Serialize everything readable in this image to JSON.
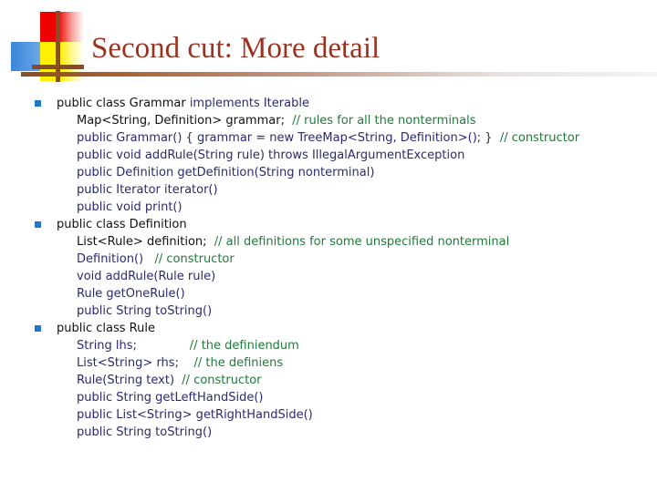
{
  "slide": {
    "title": "Second cut: More detail",
    "title_color": "#993322",
    "accent_rule_color": "#8a4c28",
    "bullet_color": "#1f78c1",
    "logo": {
      "red_color": "#ef0000",
      "blue_color": "#3a86d8",
      "yellow_color": "#ffef00",
      "cross_color": "#8a4c28"
    }
  },
  "code_groups": [
    {
      "bullet": "square-bullet",
      "lines": [
        {
          "indent": 0,
          "segments": [
            {
              "text": "public class Grammar ",
              "style": "dark"
            },
            {
              "text": "implements Iterable",
              "style": "blue"
            }
          ]
        },
        {
          "indent": 1,
          "segments": [
            {
              "text": "Map<String, Definition> grammar;  ",
              "style": "dark"
            },
            {
              "text": "// rules for all the nonterminals",
              "style": "comment"
            }
          ]
        },
        {
          "indent": 1,
          "segments": [
            {
              "text": "public Grammar() { grammar = new TreeMap<String, Definition>(); }  ",
              "style": "blue"
            },
            {
              "text": "// constructor",
              "style": "comment"
            }
          ]
        },
        {
          "indent": 1,
          "segments": [
            {
              "text": "public void addRule(String rule) throws IllegalArgumentException",
              "style": "blue"
            }
          ]
        },
        {
          "indent": 1,
          "segments": [
            {
              "text": "public Definition getDefinition(String nonterminal)",
              "style": "blue"
            }
          ]
        },
        {
          "indent": 1,
          "segments": [
            {
              "text": "public Iterator iterator()",
              "style": "blue"
            }
          ]
        },
        {
          "indent": 1,
          "segments": [
            {
              "text": "public void print()",
              "style": "blue"
            }
          ]
        }
      ]
    },
    {
      "bullet": "square-bullet",
      "lines": [
        {
          "indent": 0,
          "segments": [
            {
              "text": "public class Definition",
              "style": "dark"
            }
          ]
        },
        {
          "indent": 1,
          "segments": [
            {
              "text": "List<Rule> definition;  ",
              "style": "dark"
            },
            {
              "text": "// all definitions for some unspecified nonterminal",
              "style": "comment"
            }
          ]
        },
        {
          "indent": 1,
          "segments": [
            {
              "text": "Definition()   ",
              "style": "blue"
            },
            {
              "text": "// constructor",
              "style": "comment"
            }
          ]
        },
        {
          "indent": 1,
          "segments": [
            {
              "text": "void addRule(Rule rule)",
              "style": "blue"
            }
          ]
        },
        {
          "indent": 1,
          "segments": [
            {
              "text": "Rule getOneRule()",
              "style": "blue"
            }
          ]
        },
        {
          "indent": 1,
          "segments": [
            {
              "text": "public String toString()",
              "style": "blue"
            }
          ]
        }
      ]
    },
    {
      "bullet": "square-bullet",
      "lines": [
        {
          "indent": 0,
          "segments": [
            {
              "text": "public class Rule",
              "style": "dark"
            }
          ]
        },
        {
          "indent": 1,
          "segments": [
            {
              "text": "String lhs;              ",
              "style": "blue"
            },
            {
              "text": "// the definiendum",
              "style": "comment"
            }
          ]
        },
        {
          "indent": 1,
          "segments": [
            {
              "text": "List<String> rhs;    ",
              "style": "blue"
            },
            {
              "text": "// the definiens",
              "style": "comment"
            }
          ]
        },
        {
          "indent": 1,
          "segments": [
            {
              "text": "Rule(String text)  ",
              "style": "blue"
            },
            {
              "text": "// constructor",
              "style": "comment"
            }
          ]
        },
        {
          "indent": 1,
          "segments": [
            {
              "text": "public String getLeftHandSide()",
              "style": "blue"
            }
          ]
        },
        {
          "indent": 1,
          "segments": [
            {
              "text": "public List<String> getRightHandSide()",
              "style": "blue"
            }
          ]
        },
        {
          "indent": 1,
          "segments": [
            {
              "text": "public String toString()",
              "style": "blue"
            }
          ]
        }
      ]
    }
  ]
}
